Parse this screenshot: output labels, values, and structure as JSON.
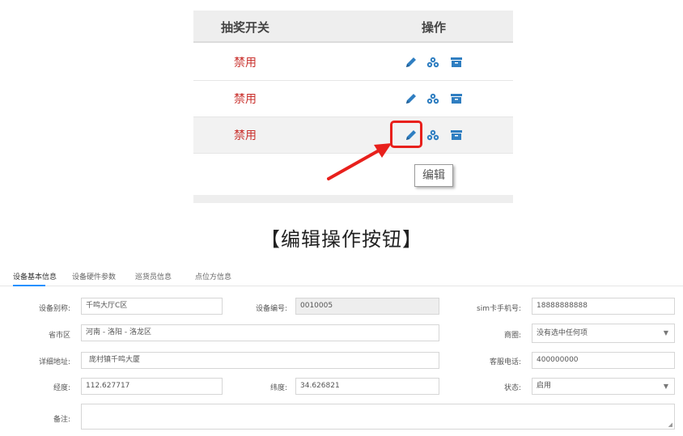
{
  "table": {
    "col_switch": "抽奖开关",
    "col_ops": "操作",
    "rows": [
      {
        "status": "禁用"
      },
      {
        "status": "禁用"
      },
      {
        "status": "禁用"
      }
    ],
    "icons": {
      "edit": "pencil-icon",
      "group": "users-icon",
      "archive": "archive-icon"
    },
    "tooltip": "编辑",
    "colors": {
      "status": "#c9302c",
      "icon": "#2f7ec1",
      "highlight": "#e8201c"
    }
  },
  "caption": "【编辑操作按钮】",
  "form": {
    "tabs": [
      "设备基本信息",
      "设备硬件参数",
      "巡货员信息",
      "点位方信息"
    ],
    "fields": {
      "alias": {
        "label": "设备别称:",
        "value": "千鸣大厅C区"
      },
      "device_no": {
        "label": "设备编号:",
        "value": "0010005"
      },
      "sim": {
        "label": "sim卡手机号:",
        "value": "18888888888"
      },
      "region": {
        "label": "省市区",
        "value": "河南 - 洛阳 - 洛龙区"
      },
      "merchant": {
        "label": "商圈:",
        "value": "没有选中任何项"
      },
      "address": {
        "label": "详细地址:",
        "value": "庞村镇千鸣大厦"
      },
      "service_phone": {
        "label": "客服电话:",
        "value": "400000000"
      },
      "longitude": {
        "label": "经度:",
        "value": "112.627717"
      },
      "latitude": {
        "label": "纬度:",
        "value": "34.626821"
      },
      "state": {
        "label": "状态:",
        "value": "启用"
      },
      "remark": {
        "label": "备注:",
        "value": ""
      }
    },
    "accent": "#1e90ff"
  }
}
